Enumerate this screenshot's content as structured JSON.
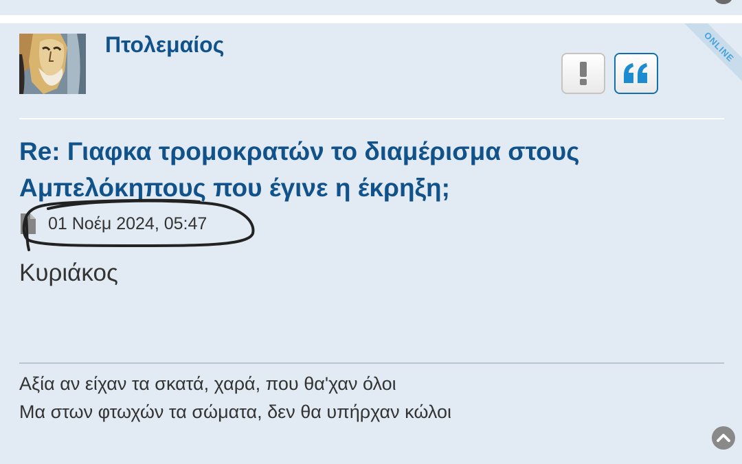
{
  "author": {
    "name": "Πτολεμαίος",
    "online_label": "ONLINE"
  },
  "actions": {
    "report_icon": "exclamation-icon",
    "quote_icon": "quote-icon"
  },
  "post": {
    "title": "Re: Γιαφκα τρομοκρατών το διαμέρισμα στους Αμπελόκηπους που έγινε η έκρηξη;",
    "date": "01 Νοέμ 2024, 05:47",
    "content": "Κυριάκος"
  },
  "signature": {
    "lines": [
      "Αξία αν είχαν τα σκατά, χαρά, που θα'χαν όλοι",
      "Μα στων φτωχών τα σώματα, δεν θα υπήρχαν κώλοι"
    ]
  },
  "colors": {
    "accent": "#105289",
    "panel_bg": "#e2ebf3",
    "quote_border": "#0f6fb0",
    "online_ribbon": "#c8dcec",
    "online_text": "#47a3da"
  }
}
